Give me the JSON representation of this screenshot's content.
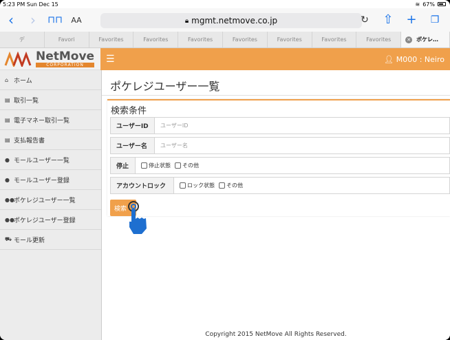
{
  "status": {
    "time": "5:23 PM",
    "date": "Sun Dec 15",
    "battery": "67%"
  },
  "browser": {
    "reader_label": "AA",
    "url": "mgmt.netmove.co.jp",
    "favorites": [
      "デ",
      "Favori",
      "Favorites",
      "Favorites",
      "Favorites",
      "Favorites",
      "Favorites",
      "Favorites",
      "Favorites",
      "Favorites"
    ],
    "active_tab": "ポケレ…"
  },
  "brand": {
    "name": "NetMove",
    "sub": "CORPORATION",
    "colors": {
      "accent": "#f0a04b",
      "sidebar": "#ececec"
    }
  },
  "header": {
    "user": "M000 : Neiro"
  },
  "sidebar": {
    "items": [
      {
        "label": "ホーム",
        "icon": "home-icon"
      },
      {
        "label": "取引一覧",
        "icon": "document-icon"
      },
      {
        "label": "電子マネー取引一覧",
        "icon": "document-icon"
      },
      {
        "label": "支払報告書",
        "icon": "document-icon"
      },
      {
        "label": "モールユーザー一覧",
        "icon": "user-icon"
      },
      {
        "label": "モールユーザー登録",
        "icon": "user-icon"
      },
      {
        "label": "ポケレジユーザー一覧",
        "icon": "users-icon"
      },
      {
        "label": "ポケレジユーザー登録",
        "icon": "users-icon"
      },
      {
        "label": "モール更新",
        "icon": "cart-icon"
      }
    ]
  },
  "main": {
    "title": "ポケレジユーザー一覧",
    "panel_title": "検索条件",
    "user_id": {
      "label": "ユーザーID",
      "placeholder": "ユーザーID"
    },
    "user_name": {
      "label": "ユーザー名",
      "placeholder": "ユーザー名"
    },
    "stop": {
      "label": "停止",
      "options": [
        "停止状態",
        "その他"
      ]
    },
    "lock": {
      "label": "アカウントロック",
      "options": [
        "ロック状態",
        "その他"
      ]
    },
    "search_button": "検索",
    "footer": "Copyright 2015 NetMove All Rights Reserved."
  }
}
